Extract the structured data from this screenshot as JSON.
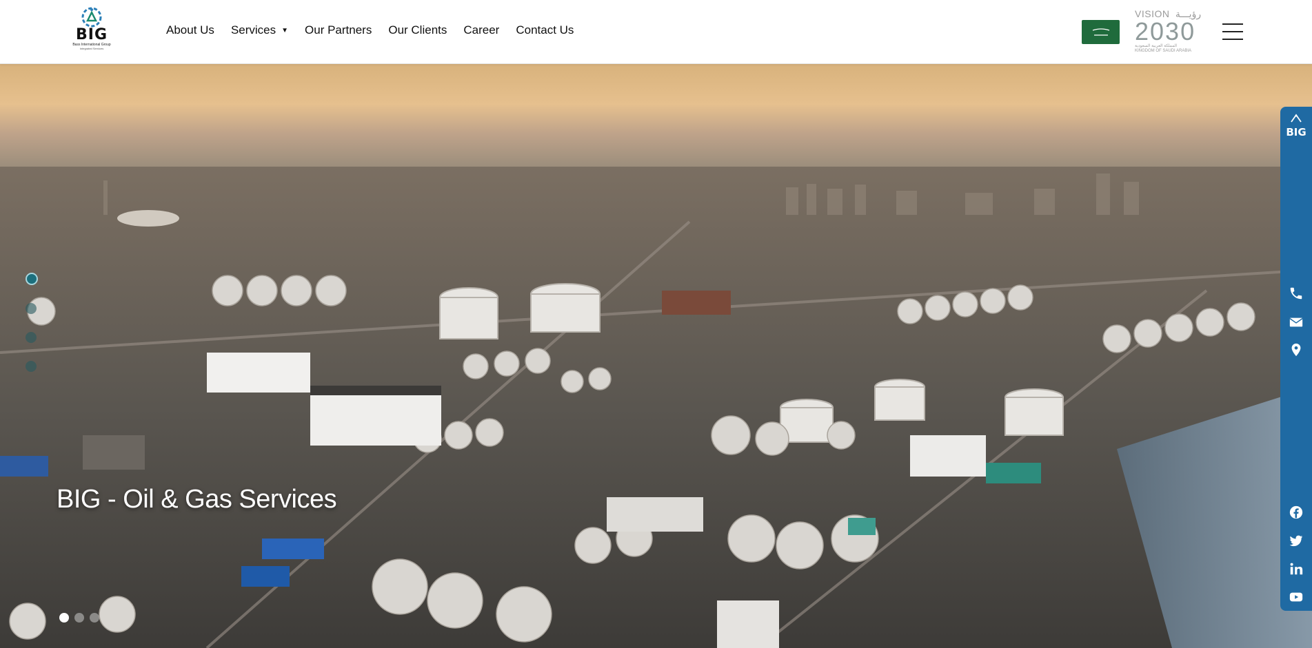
{
  "header": {
    "logo": {
      "text": "BIG",
      "subtitle": "Bass International Group",
      "tagline": "Integrated Services"
    },
    "nav": [
      {
        "label": "About Us"
      },
      {
        "label": "Services",
        "has_dropdown": true
      },
      {
        "label": "Our Partners"
      },
      {
        "label": "Our Clients"
      },
      {
        "label": "Career"
      },
      {
        "label": "Contact Us"
      }
    ],
    "vision": {
      "title": "VISION",
      "arabic_title": "رؤيـــة",
      "year": "2030",
      "arabic_subtitle": "المملكة العربية السعودية",
      "subtitle": "KINGDOM OF SAUDI ARABIA"
    },
    "icons": {
      "flag": "saudi-flag-icon",
      "menu": "hamburger-menu-icon"
    }
  },
  "hero": {
    "title": "BIG - Oil & Gas Services",
    "vertical_indicator_count": 4,
    "vertical_indicator_active": 0,
    "carousel_dot_count": 3,
    "carousel_dot_active": 0
  },
  "sidebar": {
    "logo_text": "BIG",
    "contact_icons": [
      "phone-icon",
      "email-icon",
      "location-icon"
    ],
    "social_icons": [
      "facebook-icon",
      "twitter-icon",
      "linkedin-icon",
      "youtube-icon"
    ],
    "color": "#1f6aa3"
  },
  "colors": {
    "accent": "#1f6aa3",
    "flag_green": "#1f6b3c",
    "vision_teal": "#2f8c7e"
  }
}
